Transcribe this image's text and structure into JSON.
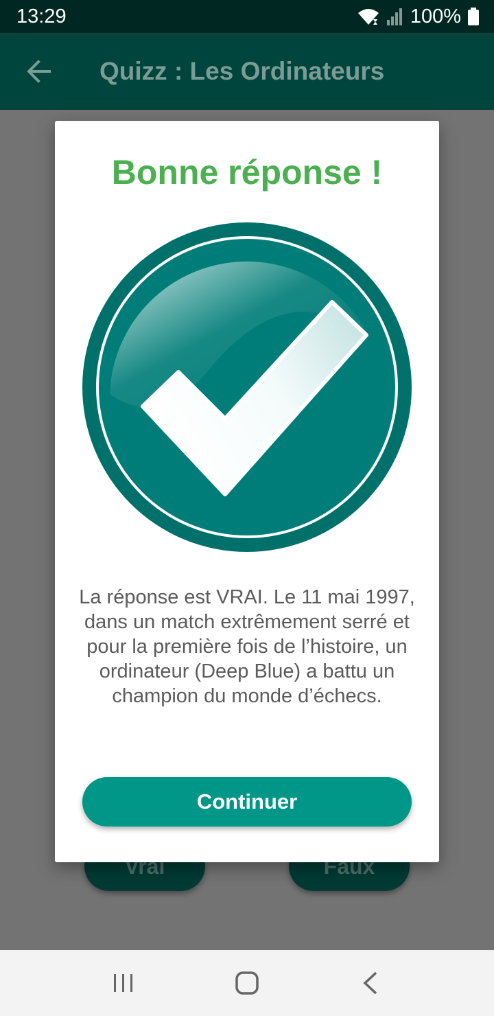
{
  "status_bar": {
    "time": "13:29",
    "battery_percent": "100%",
    "icons": [
      "wifi-icon",
      "signal-icon",
      "battery-icon"
    ]
  },
  "app_bar": {
    "title": "Quizz : Les Ordinateurs",
    "back_icon": "arrow-left-icon"
  },
  "background_buttons": {
    "true_label": "Vrai",
    "false_label": "Faux"
  },
  "dialog": {
    "title": "Bonne réponse !",
    "icon": "check-circle-icon",
    "explanation": "La réponse est VRAI. Le 11 mai 1997, dans un match extrêmement serré et pour la première fois de l’histoire, un ordinateur (Deep Blue) a battu un champion du monde d’échecs.",
    "continue_label": "Continuer"
  },
  "nav_bar": {
    "icons": [
      "recent-apps-icon",
      "home-icon",
      "back-icon"
    ]
  },
  "colors": {
    "status_bar": "#002722",
    "app_bar": "#00453d",
    "title_green": "#4caf50",
    "teal": "#009688",
    "check_circle": "#007d78"
  }
}
